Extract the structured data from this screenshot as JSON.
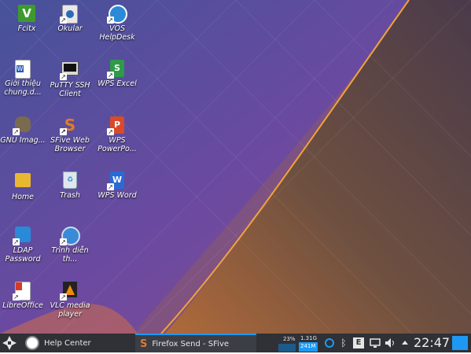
{
  "desktop": {
    "icons": [
      {
        "label": "Fcitx",
        "icon": "fcitx-icon"
      },
      {
        "label": "Okular",
        "icon": "okular-icon"
      },
      {
        "label": "VOS HelpDesk",
        "icon": "vos-helpdesk-icon"
      },
      {
        "label": "Giới thiệu chung.d...",
        "icon": "word-document-icon"
      },
      {
        "label": "PuTTY SSH Client",
        "icon": "putty-icon"
      },
      {
        "label": "WPS Excel",
        "icon": "wps-excel-icon"
      },
      {
        "label": "GNU Imag...",
        "icon": "gimp-icon"
      },
      {
        "label": "SFive Web Browser",
        "icon": "sfive-browser-icon"
      },
      {
        "label": "WPS PowerPo...",
        "icon": "wps-powerpoint-icon"
      },
      {
        "label": "Home",
        "icon": "home-folder-icon"
      },
      {
        "label": "Trash",
        "icon": "trash-icon"
      },
      {
        "label": "WPS Word",
        "icon": "wps-word-icon"
      },
      {
        "label": "LDAP Password",
        "icon": "ldap-password-icon"
      },
      {
        "label": "Trình diễn th...",
        "icon": "presentation-icon"
      },
      {
        "label": "LibreOffice",
        "icon": "libreoffice-icon"
      },
      {
        "label": "VLC media player",
        "icon": "vlc-icon"
      }
    ]
  },
  "taskbar": {
    "start_icon": "app-launcher-icon",
    "tasks": [
      {
        "label": "Help Center",
        "icon": "help-center-icon"
      },
      {
        "label": "Firefox Send - SFive",
        "icon": "sfive-browser-icon"
      }
    ],
    "system_monitor": {
      "cpu_percent": "23%",
      "memory_total": "1.31G",
      "memory_used": "241M"
    },
    "tray_icons": [
      "network-icon",
      "bluetooth-icon",
      "e-input-icon",
      "display-icon",
      "volume-icon",
      "tray-expand-icon"
    ],
    "clock": "22:47"
  },
  "colors": {
    "taskbar": "#2f3136",
    "accent": "#1d99f3"
  }
}
